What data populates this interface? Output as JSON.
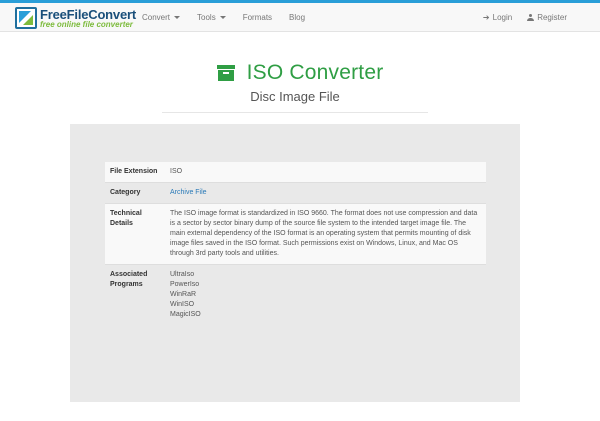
{
  "brand": {
    "name": "FreeFileConvert",
    "tagline": "free online file converter"
  },
  "nav": {
    "left": [
      {
        "label": "Convert",
        "dropdown": true
      },
      {
        "label": "Tools",
        "dropdown": true
      },
      {
        "label": "Formats",
        "dropdown": false
      },
      {
        "label": "Blog",
        "dropdown": false
      }
    ],
    "login": "Login",
    "register": "Register"
  },
  "page": {
    "title": "ISO Converter",
    "subtitle": "Disc Image File",
    "title_color": "#2f9e44"
  },
  "info": {
    "file_extension_label": "File Extension",
    "file_extension": "ISO",
    "category_label": "Category",
    "category": "Archive File",
    "technical_label": "Technical Details",
    "technical": "The ISO image format is standardized in ISO 9660. The format does not use compression and data is a sector by sector binary dump of the source file system to the intended target image file. The main external dependency of the ISO format is an operating system that permits mounting of disk image files saved in the ISO format. Such permissions exist on Windows, Linux, and Mac OS through 3rd party tools and utilities.",
    "programs_label": "Associated Programs",
    "programs": [
      "UltraIso",
      "PowerIso",
      "WinRaR",
      "WinISO",
      "MagicISO"
    ]
  }
}
